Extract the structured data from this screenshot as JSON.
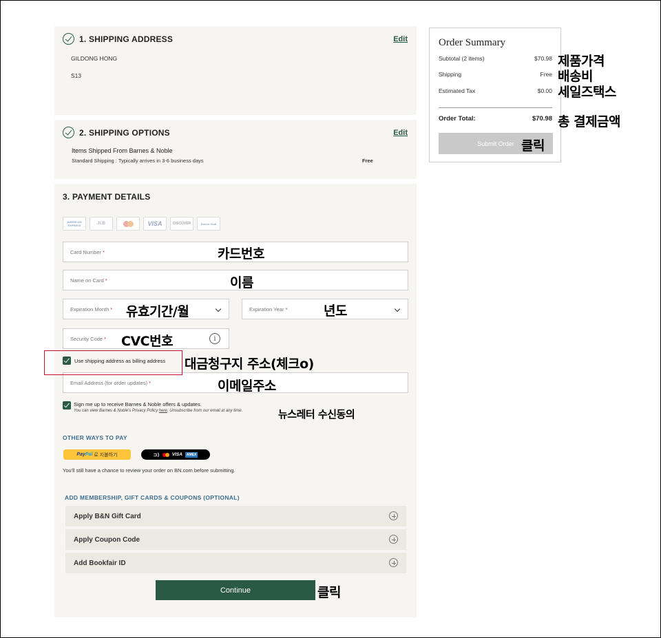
{
  "shipping_address": {
    "title": "1. SHIPPING ADDRESS",
    "edit_label": "Edit",
    "name": "GILDONG HONG",
    "line": "S13"
  },
  "shipping_options": {
    "title": "2. SHIPPING OPTIONS",
    "edit_label": "Edit",
    "heading": "Items Shipped From Barnes & Noble",
    "method": "Standard Shipping : Typically arrives in 3-6 business days",
    "price": "Free"
  },
  "payment": {
    "title": "3. PAYMENT DETAILS",
    "cards": [
      "AMERICAN EXPRESS",
      "JCB",
      "mastercard",
      "VISA",
      "DISCOVER",
      "Diners Club"
    ],
    "fields": {
      "card_number": "Card Number",
      "name_on_card": "Name on Card",
      "exp_month": "Expiration Month",
      "exp_year": "Expiration Year",
      "security_code": "Security Code",
      "email": "Email Address (for order updates)",
      "required_mark": "*"
    },
    "info_glyph": "i",
    "billing_checkbox_label": "Use shipping address as billing address",
    "signup_label": "Sign me up to receive Barnes & Noble offers & updates.",
    "privacy_pre": "You can view Barnes & Noble's Privacy Policy ",
    "privacy_link": "here",
    "privacy_post": ". Unsubscribe from our email at any time.",
    "other_ways_title": "OTHER WAYS TO PAY",
    "paypal": {
      "pay": "Pay",
      "pal": "Pal",
      "ko": "로 지불하기"
    },
    "clicktopay": {
      "visa": "VISA",
      "amex": "AMEX"
    },
    "review_note": "You'll still have a chance to review your order on BN.com before submitting.",
    "membership_title": "ADD MEMBERSHIP, GIFT CARDS & COUPONS (OPTIONAL)",
    "accordions": [
      "Apply B&N Gift Card",
      "Apply Coupon Code",
      "Add Bookfair ID"
    ],
    "continue_label": "Continue"
  },
  "order_summary": {
    "title": "Order Summary",
    "subtotal_label": "Subtotal (2 items)",
    "subtotal_value": "$70.98",
    "shipping_label": "Shipping",
    "shipping_value": "Free",
    "tax_label": "Estimated Tax",
    "tax_value": "$0.00",
    "total_label": "Order Total:",
    "total_value": "$70.98",
    "submit_label": "Submit Order"
  },
  "annotations": {
    "product_price": "제품가격",
    "shipping_fee": "배송비",
    "sales_tax": "세일즈택스",
    "total_payment": "총 결제금액",
    "click_submit": "클릭",
    "card_number": "카드번호",
    "name": "이름",
    "expiry_month": "유효기간/월",
    "year": "년도",
    "cvc": "CVC번호",
    "billing": "대금청구지 주소(체크o)",
    "email": "이메일주소",
    "newsletter": "뉴스레터 수신동의",
    "click_continue": "클릭"
  },
  "colors": {
    "accent_green": "#2b5a44",
    "link_blue": "#3e6d8e",
    "highlight_red": "#c8102e"
  }
}
